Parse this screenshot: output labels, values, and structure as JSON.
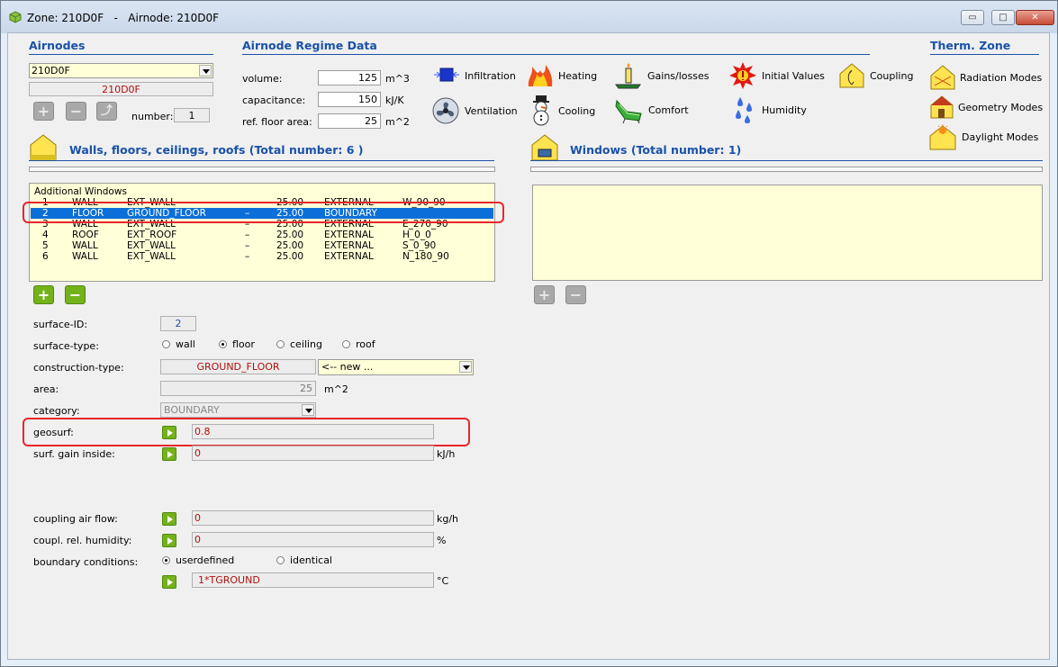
{
  "window": {
    "title": "Zone: 210D0F   -   Airnode: 210D0F",
    "min_label": "▭",
    "max_label": "□",
    "close_label": "✕"
  },
  "airnodes": {
    "title": "Airnodes",
    "select_value": "210D0F",
    "name_display": "210D0F",
    "number_label": "number:",
    "number_value": "1"
  },
  "regime": {
    "title": "Airnode Regime Data",
    "volume_label": "volume:",
    "volume_value": "125",
    "volume_unit": "m^3",
    "capacitance_label": "capacitance:",
    "capacitance_value": "150",
    "capacitance_unit": "kJ/K",
    "floor_label": "ref. floor area:",
    "floor_value": "25",
    "floor_unit": "m^2",
    "tools": {
      "infiltration": "Infiltration",
      "heating": "Heating",
      "gains": "Gains/losses",
      "initial": "Initial Values",
      "coupling": "Coupling",
      "ventilation": "Ventilation",
      "cooling": "Cooling",
      "comfort": "Comfort",
      "humidity": "Humidity"
    }
  },
  "therm_zone": {
    "title": "Therm. Zone",
    "radiation": "Radiation Modes",
    "geometry": "Geometry Modes",
    "daylight": "Daylight Modes"
  },
  "walls": {
    "title": "Walls, floors, ceilings, roofs (Total number: 6 )",
    "header_row": "Additional Windows",
    "rows": [
      {
        "id": "1",
        "type": "WALL",
        "construction": "EXT_WALL",
        "dash": "–",
        "area": "25.00",
        "category": "EXTERNAL",
        "geo": "W_90_90"
      },
      {
        "id": "2",
        "type": "FLOOR",
        "construction": "GROUND_FLOOR",
        "dash": "–",
        "area": "25.00",
        "category": "BOUNDARY",
        "geo": ""
      },
      {
        "id": "3",
        "type": "WALL",
        "construction": "EXT_WALL",
        "dash": "–",
        "area": "25.00",
        "category": "EXTERNAL",
        "geo": "E_270_90"
      },
      {
        "id": "4",
        "type": "ROOF",
        "construction": "EXT_ROOF",
        "dash": "–",
        "area": "25.00",
        "category": "EXTERNAL",
        "geo": "H_0_0"
      },
      {
        "id": "5",
        "type": "WALL",
        "construction": "EXT_WALL",
        "dash": "–",
        "area": "25.00",
        "category": "EXTERNAL",
        "geo": "S_0_90"
      },
      {
        "id": "6",
        "type": "WALL",
        "construction": "EXT_WALL",
        "dash": "–",
        "area": "25.00",
        "category": "EXTERNAL",
        "geo": "N_180_90"
      }
    ]
  },
  "windows": {
    "title": "Windows (Total number: 1)"
  },
  "surface": {
    "id_label": "surface-ID:",
    "id_value": "2",
    "type_label": "surface-type:",
    "type_wall": "wall",
    "type_floor": "floor",
    "type_ceiling": "ceiling",
    "type_roof": "roof",
    "construction_label": "construction-type:",
    "construction_value": "GROUND_FLOOR",
    "construction_new": "<-- new ...",
    "area_label": "area:",
    "area_value": "25",
    "area_unit": "m^2",
    "category_label": "category:",
    "category_value": "BOUNDARY",
    "geosurf_label": "geosurf:",
    "geosurf_value": "0.8",
    "gain_label": "surf. gain inside:",
    "gain_value": "0",
    "gain_unit": "kJ/h",
    "airflow_label": "coupling air flow:",
    "airflow_value": "0",
    "airflow_unit": "kg/h",
    "humidity_label": "coupl. rel. humidity:",
    "humidity_value": "0",
    "humidity_unit": "%",
    "boundary_label": "boundary conditions:",
    "bc_userdefined": "userdefined",
    "bc_identical": "identical",
    "bc_value": "1*TGROUND",
    "bc_unit": "°C"
  }
}
